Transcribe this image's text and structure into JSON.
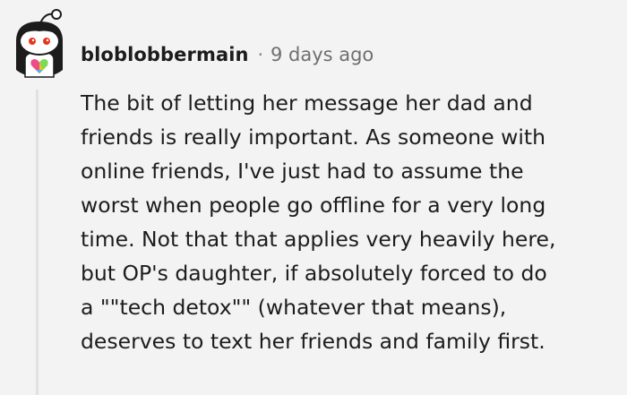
{
  "comment": {
    "author": "bloblobbermain",
    "separator": "·",
    "timestamp": "9 days ago",
    "avatar_icon": "snoo-avatar-with-rainbow-heart",
    "body_lines": [
      "The bit of letting her message her dad and",
      "friends is really important. As someone with",
      "online friends, I've just had to assume the",
      "worst when people go offline for a very long",
      "time. Not that that applies very heavily here,",
      "but OP's daughter, if absolutely forced to do",
      "a \"\"tech detox\"\" (whatever that means),",
      "deserves to text her friends and family first."
    ]
  },
  "colors": {
    "background": "#f3f3f4",
    "text": "#1c1c1c",
    "meta": "#6f6f6f",
    "thread_line": "#e1e1e3"
  }
}
